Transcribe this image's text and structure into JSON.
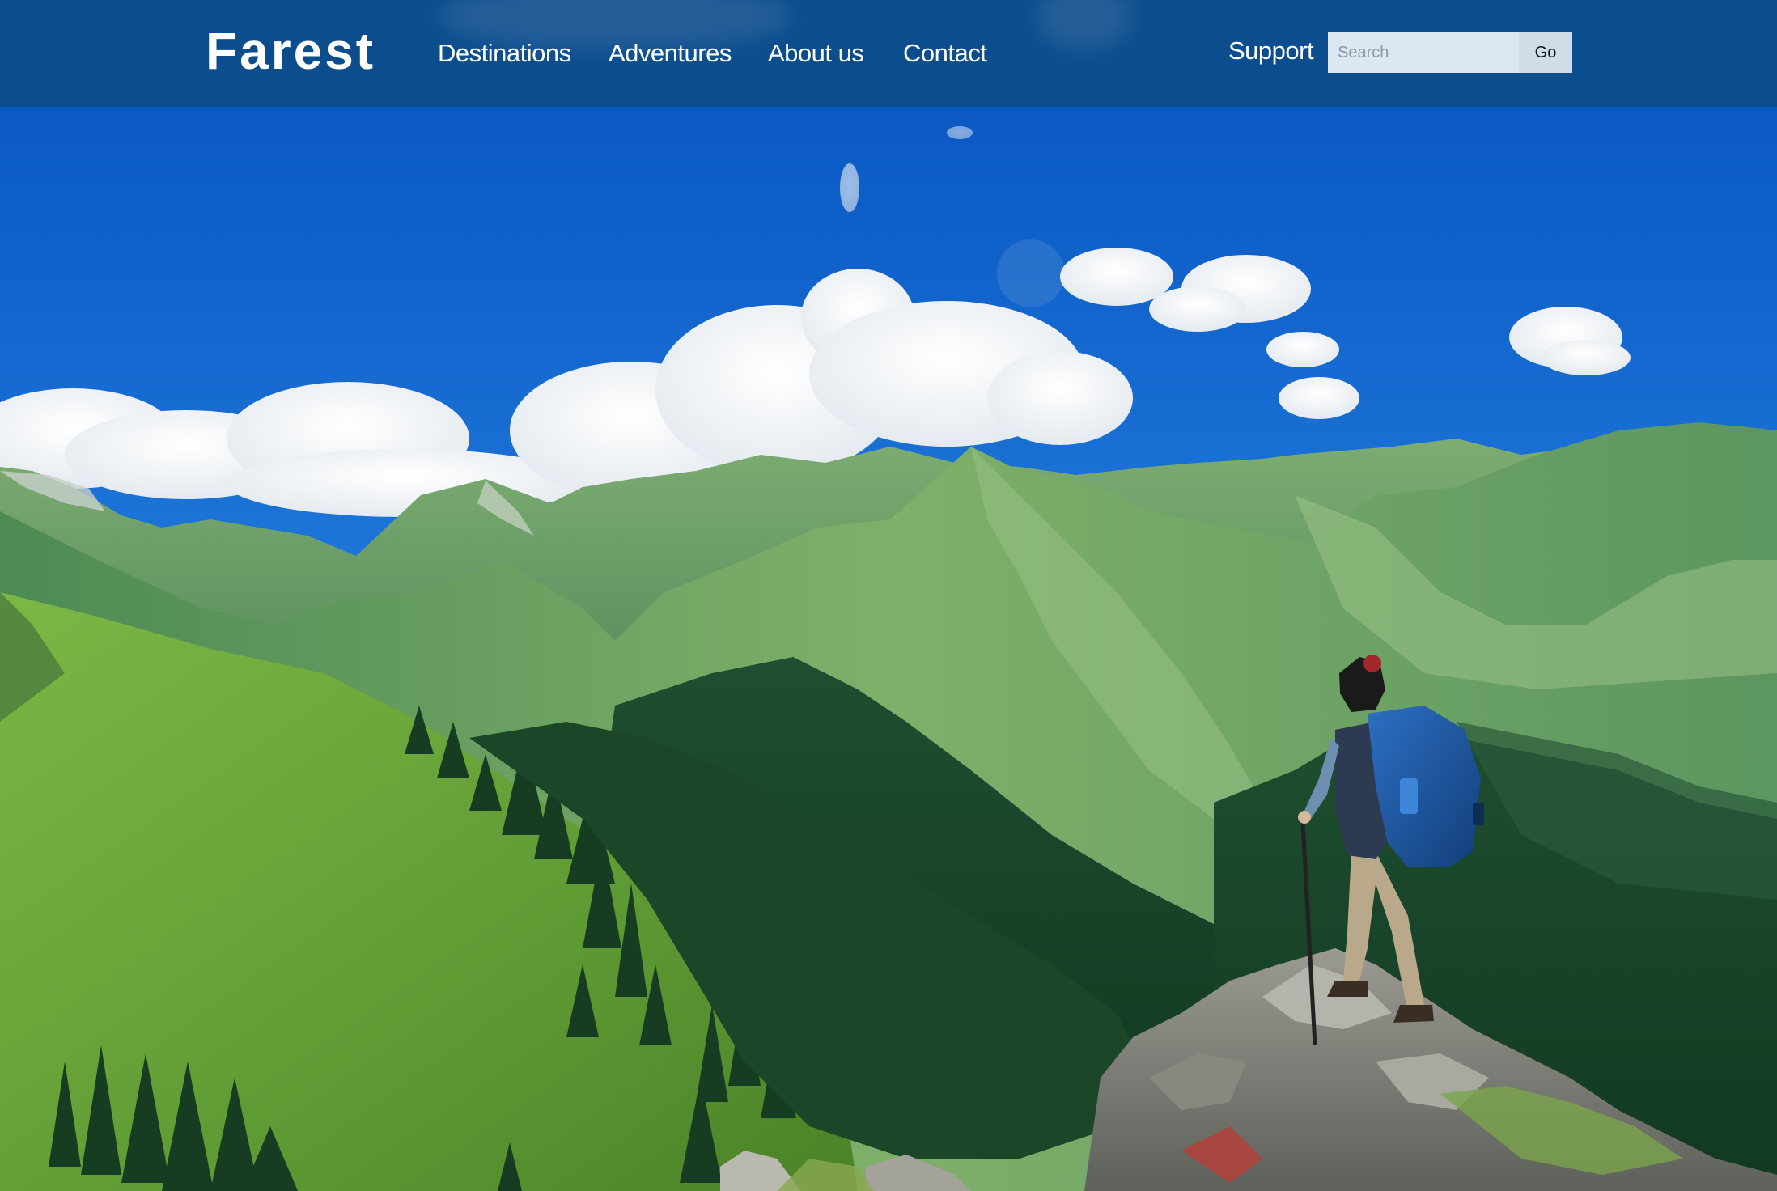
{
  "header": {
    "logo": "Farest",
    "nav": [
      {
        "label": "Destinations"
      },
      {
        "label": "Adventures"
      },
      {
        "label": "About us"
      },
      {
        "label": "Contact"
      }
    ],
    "support_label": "Support",
    "search": {
      "placeholder": "Search",
      "button_label": "Go"
    }
  },
  "hero": {
    "image": "hiker-on-mountain-ridge-photo"
  },
  "colors": {
    "header_bg": "#0c4d8e",
    "sky": "#1a6fd1",
    "meadow": "#6aa63a",
    "forest": "#1c4a2a"
  }
}
